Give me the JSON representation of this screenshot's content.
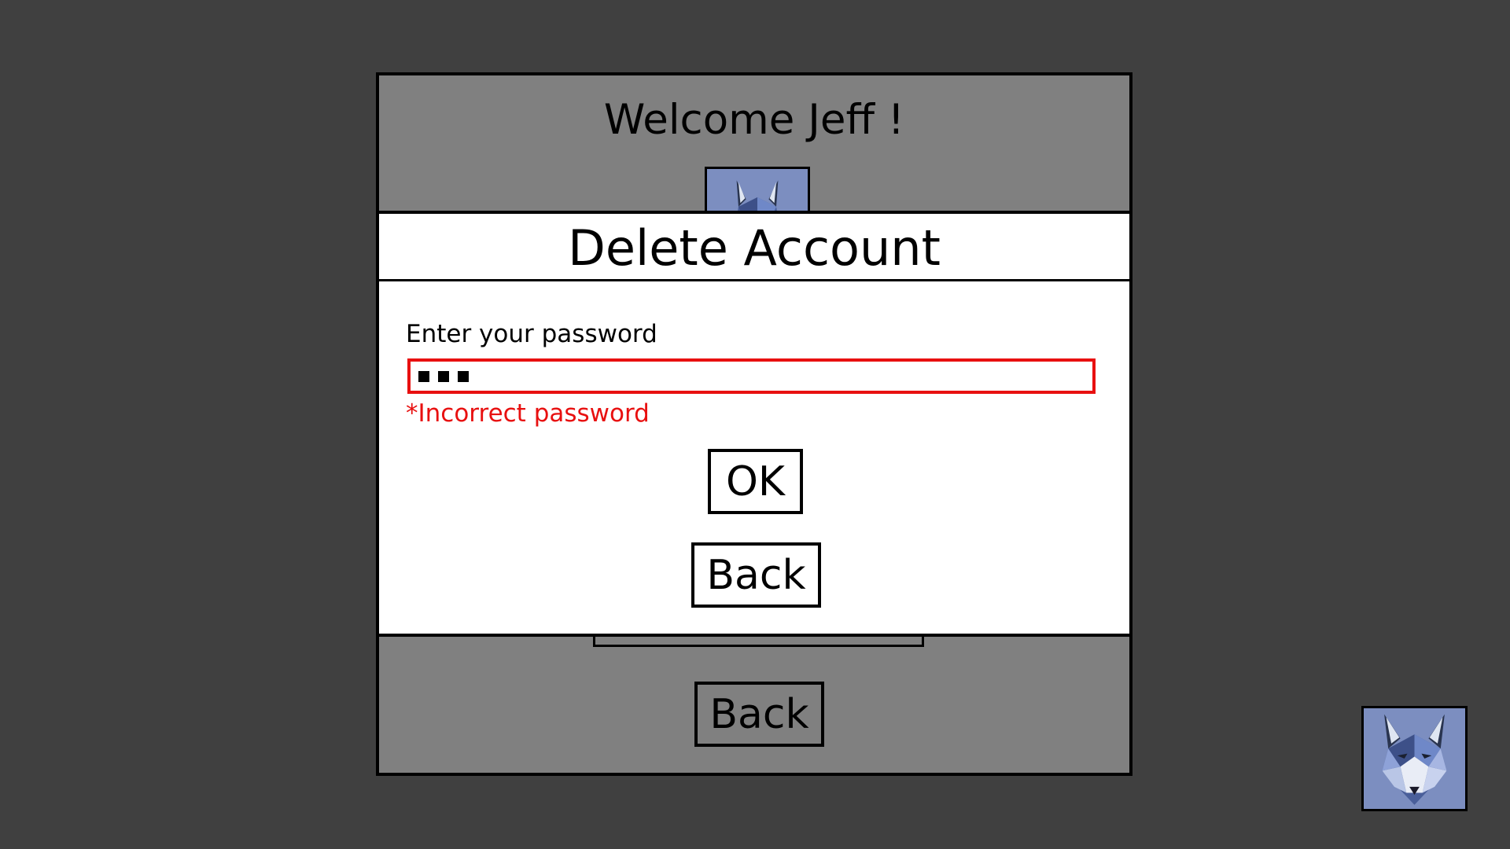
{
  "screen": {
    "background_color": "#404040"
  },
  "profile_panel": {
    "welcome_title": "Welcome Jeff !",
    "avatar_icon": "wolf-avatar-icon",
    "back_button_label": "Back",
    "background_color": "#808080"
  },
  "delete_dialog": {
    "title": "Delete Account",
    "password_label": "Enter your password",
    "password_masked_length": 3,
    "error_message": "*Incorrect password",
    "error_color": "#e81010",
    "ok_button_label": "OK",
    "back_button_label": "Back"
  },
  "corner_avatar": {
    "icon": "wolf-avatar-icon",
    "background_color": "#7c8ec0"
  }
}
